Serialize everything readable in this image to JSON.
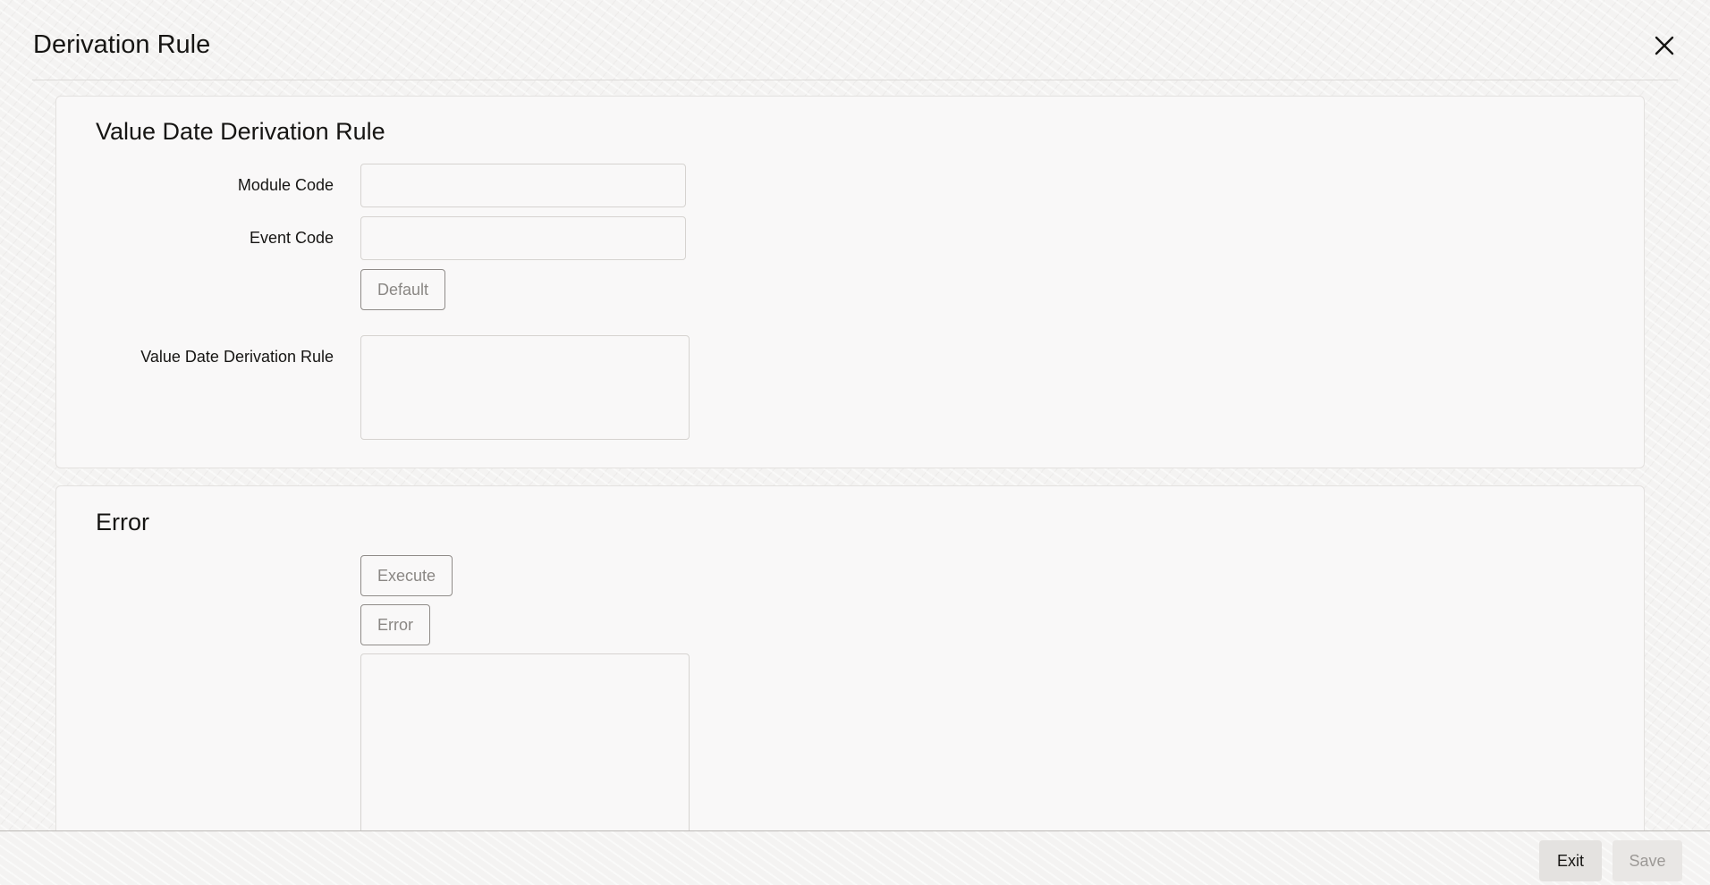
{
  "dialog": {
    "title": "Derivation Rule"
  },
  "value_date_section": {
    "title": "Value Date Derivation Rule",
    "module_code_label": "Module Code",
    "module_code_value": "",
    "event_code_label": "Event Code",
    "event_code_value": "",
    "default_button": "Default",
    "rule_label": "Value Date Derivation Rule",
    "rule_value": ""
  },
  "error_section": {
    "title": "Error",
    "execute_button": "Execute",
    "error_button": "Error",
    "error_text": ""
  },
  "footer": {
    "exit_button": "Exit",
    "save_button": "Save"
  },
  "icons": {
    "close": "close-icon"
  },
  "colors": {
    "text": "#161513",
    "button_border": "#8f8b88",
    "disabled_text": "#9c9996"
  }
}
